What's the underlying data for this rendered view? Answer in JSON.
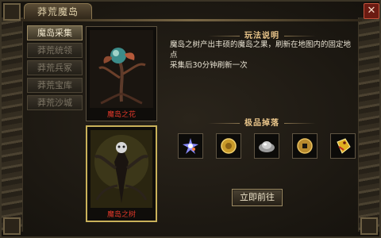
{
  "window": {
    "title": "莽荒魔岛",
    "close_label": "✕"
  },
  "side_tabs": [
    {
      "label": "魔岛采集",
      "active": true
    },
    {
      "label": "莽荒统领",
      "active": false
    },
    {
      "label": "莽荒兵冢",
      "active": false
    },
    {
      "label": "莽荒宝库",
      "active": false
    },
    {
      "label": "莽荒沙城",
      "active": false
    }
  ],
  "cards": [
    {
      "caption": "魔岛之花",
      "selected": false
    },
    {
      "caption": "魔岛之树",
      "selected": true
    }
  ],
  "gameplay": {
    "heading": "玩法说明",
    "line1": "魔岛之树产出丰硕的魔岛之果，刷新在地图内的固定地点",
    "line2": "采集后30分钟刷新一次"
  },
  "drops": {
    "heading": "极品掉落",
    "items": [
      {
        "icon": "crystal-star-icon"
      },
      {
        "icon": "gold-coin-icon"
      },
      {
        "icon": "silver-ingot-icon"
      },
      {
        "icon": "copper-coin-icon"
      },
      {
        "icon": "golden-tag-icon"
      }
    ]
  },
  "actions": {
    "go_label": "立即前往"
  },
  "colors": {
    "caption_red": "#e0382a",
    "heading_gold": "#e9c58a",
    "selected_border": "#c9b15a"
  }
}
